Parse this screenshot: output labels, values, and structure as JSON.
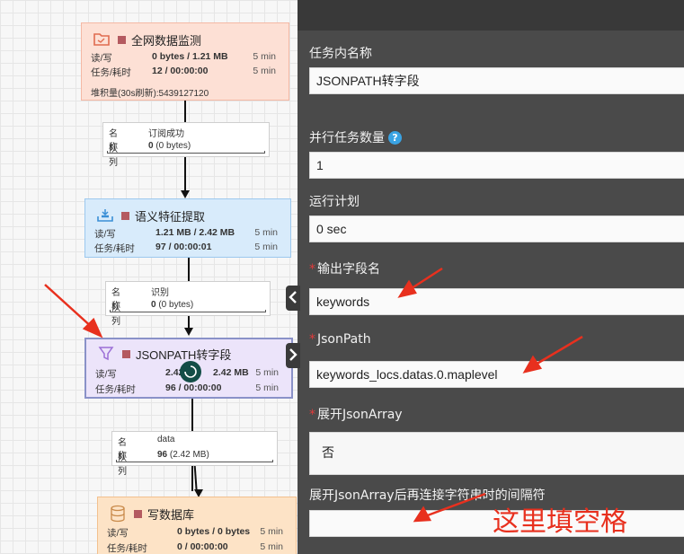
{
  "colors": {
    "annotation_red": "#e8301e",
    "node_source_bg": "#fde0d5",
    "node_extract_bg": "#d8ebfb",
    "node_json_bg": "#ece4fa",
    "node_db_bg": "#fde3c6",
    "panel_bg": "#4a4a4a",
    "help_blue": "#3aa3e3"
  },
  "canvas": {
    "nodes": [
      {
        "icon": "folder-icon",
        "title": "全网数据监测",
        "rw_label": "读/写",
        "rw_value": "0 bytes / 1.21 MB",
        "rw_time": "5 min",
        "task_label": "任务/耗时",
        "task_value": "12 / 00:00:00",
        "task_time": "5 min",
        "extra": "堆积量(30s刷新):5439127120"
      },
      {
        "icon": "inbox-tray-icon",
        "title": "语义特征提取",
        "rw_label": "读/写",
        "rw_value": "1.21 MB / 2.42 MB",
        "rw_time": "5 min",
        "task_label": "任务/耗时",
        "task_value": "97 / 00:00:01",
        "task_time": "5 min"
      },
      {
        "icon": "filter-icon",
        "title": "JSONPATH转字段",
        "rw_label": "读/写",
        "rw_value": "2.42",
        "rw_value2": "2.42 MB",
        "rw_time": "5 min",
        "task_label": "任务/耗时",
        "task_value": "96 / 00:00:00",
        "task_time": "5 min"
      },
      {
        "icon": "database-icon",
        "title": "写数据库",
        "rw_label": "读/写",
        "rw_value": "0 bytes / 0 bytes",
        "rw_time": "5 min",
        "task_label": "任务/耗时",
        "task_value": "0 / 00:00:00",
        "task_time": "5 min"
      }
    ],
    "connections": [
      {
        "name_label": "名称",
        "name_value": "订阅成功",
        "queue_label": "队列",
        "queue_count": "0",
        "queue_size": "(0 bytes)"
      },
      {
        "name_label": "名称",
        "name_value": "识别",
        "queue_label": "队列",
        "queue_count": "0",
        "queue_size": "(0 bytes)"
      },
      {
        "name_label": "名称",
        "name_value": "data",
        "queue_label": "队列",
        "queue_count": "96",
        "queue_size": "(2.42 MB)"
      }
    ]
  },
  "form": {
    "task_name_label": "任务内名称",
    "task_name_value": "JSONPATH转字段",
    "parallel_label": "并行任务数量",
    "parallel_value": "1",
    "schedule_label": "运行计划",
    "schedule_value": "0 sec",
    "output_field_label": "输出字段名",
    "output_field_value": "keywords",
    "jsonpath_label": "JsonPath",
    "jsonpath_value": "keywords_locs.datas.0.maplevel",
    "expand_label": "展开JsonArray",
    "expand_value": "否",
    "separator_label": "展开JsonArray后再连接字符串时的间隔符",
    "separator_value": ""
  },
  "annotation": {
    "note": "这里填空格"
  }
}
